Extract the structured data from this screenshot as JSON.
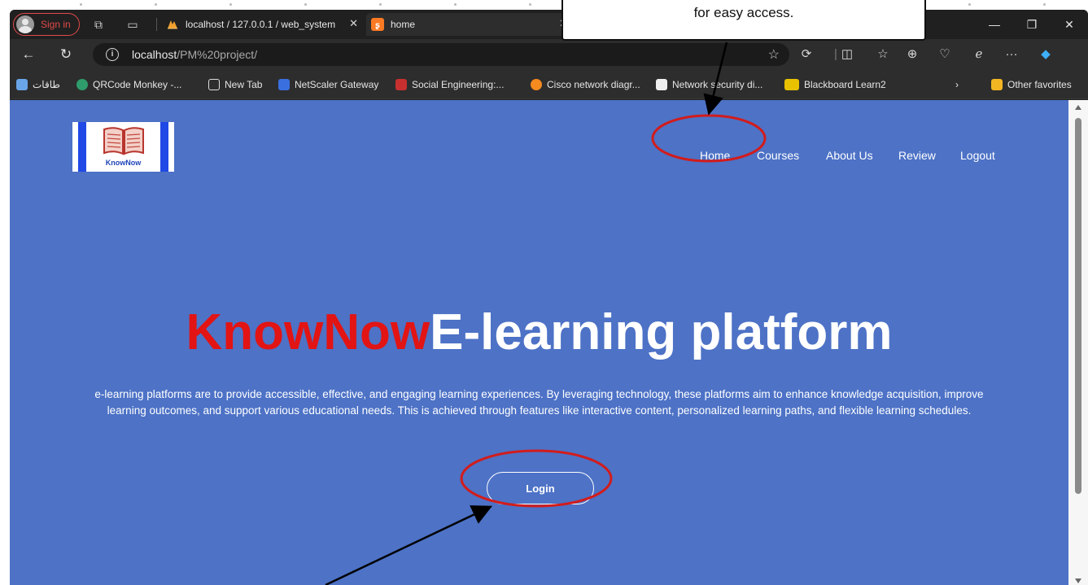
{
  "browser": {
    "profile_label": "Sign in",
    "tabs": [
      {
        "title": "localhost / 127.0.0.1 / web_system",
        "active": false
      },
      {
        "title": "home",
        "active": true
      }
    ],
    "url_host": "localhost",
    "url_path": "/PM%20project/",
    "bookmarks": [
      {
        "label": "طاقات",
        "icon": "image-icon"
      },
      {
        "label": "QRCode Monkey -...",
        "icon": "qr-icon"
      },
      {
        "label": "New Tab",
        "icon": "page-icon"
      },
      {
        "label": "NetScaler Gateway",
        "icon": "lock-icon"
      },
      {
        "label": "Social Engineering:...",
        "icon": "red-badge-icon"
      },
      {
        "label": "Cisco network diagr...",
        "icon": "cisco-icon"
      },
      {
        "label": "Network security di...",
        "icon": "lucid-icon"
      },
      {
        "label": "Blackboard Learn2",
        "icon": "blackboard-icon"
      },
      {
        "label": "Other favorites",
        "icon": "folder-icon"
      }
    ]
  },
  "site": {
    "logo_text": "KnowNow",
    "nav": [
      "Home",
      "Courses",
      "About Us",
      "Review",
      "Logout"
    ],
    "hero": {
      "brand": "KnowNow",
      "title_rest": "E-learning platform",
      "description": "e-learning platforms are to provide accessible, effective, and engaging learning experiences. By leveraging technology, these platforms aim to enhance knowledge acquisition, improve learning outcomes, and support various educational needs. This is achieved through features like interactive content, personalized learning paths, and flexible learning schedules.",
      "login_label": "Login"
    }
  },
  "annotation": {
    "callout_text": "for easy access.",
    "color": "#d21c1c"
  },
  "colors": {
    "page_bg": "#4d72c6",
    "brand_red": "#e21414",
    "logo_blue": "#2149e6"
  }
}
